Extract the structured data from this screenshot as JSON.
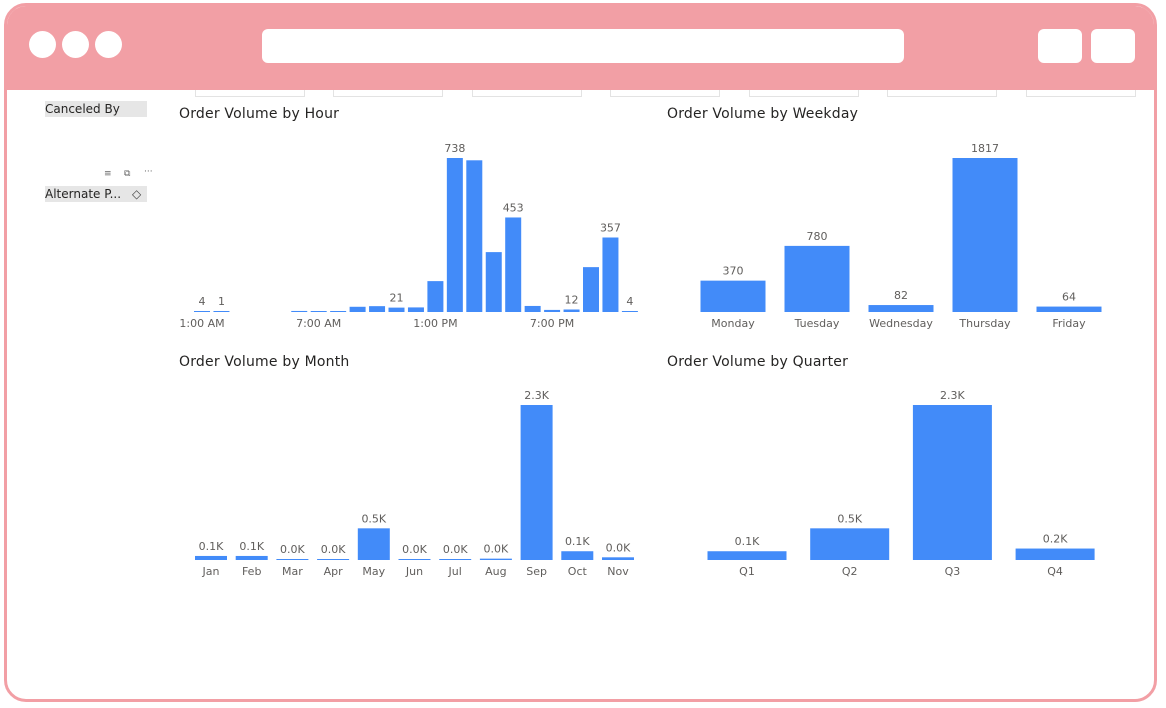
{
  "window": {
    "address_bar": "",
    "colors": {
      "chrome": "#f29fa5",
      "bar": "#428bf9",
      "text": "#252423",
      "label": "#605e5c"
    }
  },
  "filters": {
    "canceled_by": {
      "label": "Canceled By"
    },
    "alternate": {
      "label": "Alternate P...",
      "icons": [
        "filter-icon",
        "focus-mode-icon",
        "more-options-icon",
        "eraser-icon"
      ]
    }
  },
  "chart_data": [
    {
      "id": "hour",
      "type": "bar",
      "title": "Order Volume by Hour",
      "xlabel": "",
      "ylabel": "",
      "categories": [
        "1:00 AM",
        "2:00 AM",
        "3:00 AM",
        "4:00 AM",
        "5:00 AM",
        "6:00 AM",
        "7:00 AM",
        "8:00 AM",
        "9:00 AM",
        "10:00 AM",
        "11:00 AM",
        "12:00 PM",
        "1:00 PM",
        "2:00 PM",
        "3:00 PM",
        "4:00 PM",
        "5:00 PM",
        "6:00 PM",
        "7:00 PM",
        "8:00 PM",
        "9:00 PM",
        "10:00 PM",
        "11:00 PM"
      ],
      "values": [
        4,
        1,
        0,
        0,
        0,
        5,
        3,
        2,
        25,
        28,
        21,
        22,
        148,
        738,
        727,
        287,
        453,
        29,
        10,
        12,
        215,
        357,
        4
      ],
      "data_labels": {
        "1:00 AM": "4",
        "2:00 AM": "1",
        "11:00 AM": "21",
        "2:00 PM": "738",
        "5:00 PM": "453",
        "8:00 PM": "12",
        "10:00 PM": "357",
        "11:00 PM": "4"
      },
      "tick_labels": [
        "1:00 AM",
        "7:00 AM",
        "1:00 PM",
        "7:00 PM"
      ],
      "ylim": [
        0,
        738
      ],
      "grid": false,
      "legend": "none"
    },
    {
      "id": "weekday",
      "type": "bar",
      "title": "Order Volume by Weekday",
      "xlabel": "",
      "ylabel": "",
      "categories": [
        "Monday",
        "Tuesday",
        "Wednesday",
        "Thursday",
        "Friday"
      ],
      "values": [
        370,
        780,
        82,
        1817,
        64
      ],
      "data_labels": [
        "370",
        "780",
        "82",
        "1817",
        "64"
      ],
      "ylim": [
        0,
        1817
      ],
      "grid": false,
      "legend": "none"
    },
    {
      "id": "month",
      "type": "bar",
      "title": "Order Volume by Month",
      "xlabel": "",
      "ylabel": "",
      "categories": [
        "Jan",
        "Feb",
        "Mar",
        "Apr",
        "May",
        "Jun",
        "Jul",
        "Aug",
        "Sep",
        "Oct",
        "Nov"
      ],
      "values": [
        60,
        60,
        10,
        10,
        470,
        10,
        10,
        20,
        2300,
        130,
        40
      ],
      "data_labels": [
        "0.1K",
        "0.1K",
        "0.0K",
        "0.0K",
        "0.5K",
        "0.0K",
        "0.0K",
        "0.0K",
        "2.3K",
        "0.1K",
        "0.0K"
      ],
      "ylim": [
        0,
        2300
      ],
      "grid": false,
      "legend": "none"
    },
    {
      "id": "quarter",
      "type": "bar",
      "title": "Order Volume by Quarter",
      "xlabel": "",
      "ylabel": "",
      "categories": [
        "Q1",
        "Q2",
        "Q3",
        "Q4"
      ],
      "values": [
        130,
        470,
        2300,
        170
      ],
      "data_labels": [
        "0.1K",
        "0.5K",
        "2.3K",
        "0.2K"
      ],
      "ylim": [
        0,
        2300
      ],
      "grid": false,
      "legend": "none"
    }
  ]
}
